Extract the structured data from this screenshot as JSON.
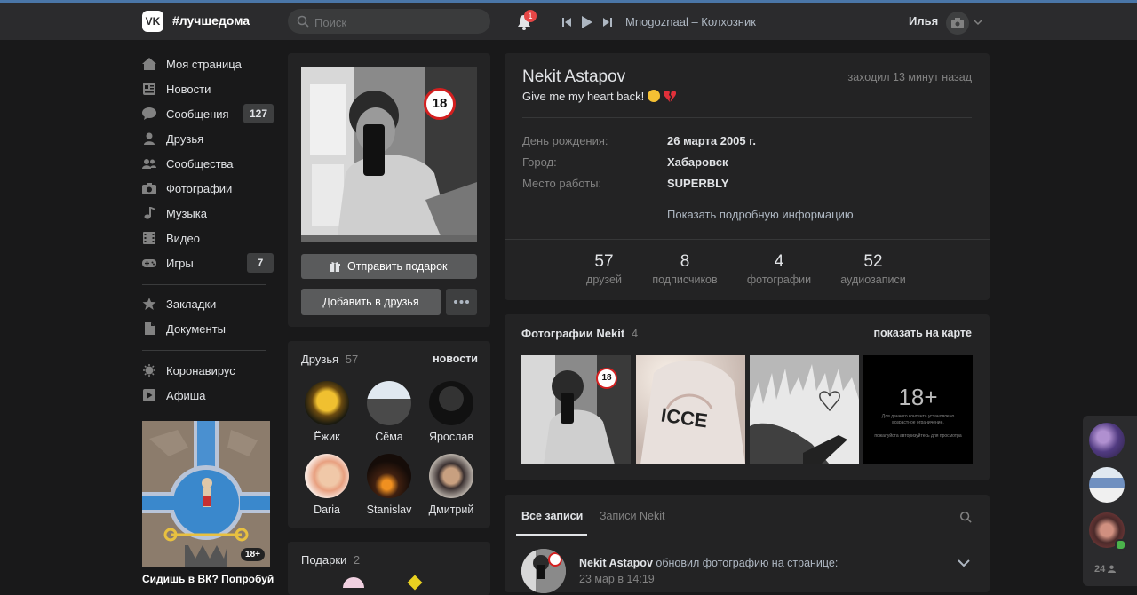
{
  "header": {
    "logo": "VK",
    "hashtag": "#лучшедома",
    "search_placeholder": "Поиск",
    "notifications_count": "1",
    "track": "Mnogoznaal – Колхозник",
    "user_name": "Илья"
  },
  "nav": {
    "items": [
      {
        "label": "Моя страница",
        "icon": "home-icon"
      },
      {
        "label": "Новости",
        "icon": "news-icon"
      },
      {
        "label": "Сообщения",
        "icon": "chat-icon",
        "count": "127"
      },
      {
        "label": "Друзья",
        "icon": "person-icon"
      },
      {
        "label": "Сообщества",
        "icon": "groups-icon"
      },
      {
        "label": "Фотографии",
        "icon": "camera-icon"
      },
      {
        "label": "Музыка",
        "icon": "music-icon"
      },
      {
        "label": "Видео",
        "icon": "video-icon"
      },
      {
        "label": "Игры",
        "icon": "gamepad-icon",
        "count": "7"
      }
    ],
    "items2": [
      {
        "label": "Закладки",
        "icon": "star-icon"
      },
      {
        "label": "Документы",
        "icon": "document-icon"
      }
    ],
    "items3": [
      {
        "label": "Коронавирус",
        "icon": "virus-icon"
      },
      {
        "label": "Афиша",
        "icon": "play-icon"
      }
    ]
  },
  "ad": {
    "badge": "18+",
    "title": "Сидишь в ВК? Попробуй"
  },
  "profile": {
    "badge18": "18",
    "gift_button": "Отправить подарок",
    "add_friend_button": "Добавить в друзья",
    "name": "Nekit Astapov",
    "status": "Give me my heart back!",
    "last_seen": "заходил 13 минут назад",
    "fields": [
      {
        "label": "День рождения:",
        "value": "26 марта 2005 г."
      },
      {
        "label": "Город:",
        "value": "Хабаровск"
      },
      {
        "label": "Место работы:",
        "value": "SUPERBLY"
      }
    ],
    "more_info": "Показать подробную информацию",
    "stats": [
      {
        "num": "57",
        "label": "друзей"
      },
      {
        "num": "8",
        "label": "подписчиков"
      },
      {
        "num": "4",
        "label": "фотографии"
      },
      {
        "num": "52",
        "label": "аудиозаписи"
      }
    ]
  },
  "friends": {
    "title": "Друзья",
    "count": "57",
    "news_link": "новости",
    "list": [
      {
        "name": "Ёжик"
      },
      {
        "name": "Сёма"
      },
      {
        "name": "Ярослав"
      },
      {
        "name": "Daria"
      },
      {
        "name": "Stanislav"
      },
      {
        "name": "Дмитрий"
      }
    ]
  },
  "gifts": {
    "title": "Подарки",
    "count": "2"
  },
  "photos": {
    "title": "Фотографии Nekit",
    "count": "4",
    "map_link": "показать на карте",
    "badge18": "18",
    "hoodie_text": "ICCE",
    "restricted_big": "18+",
    "restricted_text1": "Для данного контента установлено возрастное ограничение.",
    "restricted_text2": "пожалуйста авторизуйтесь для просмотра"
  },
  "wall": {
    "tabs": [
      "Все записи",
      "Записи Nekit"
    ],
    "post_author": "Nekit Astapov",
    "post_action": " обновил фотографию на странице:",
    "post_date": "23 мар в 14:19"
  },
  "rightbar": {
    "count": "24"
  },
  "colors": {
    "accent": "#4a76a8",
    "background": "#19191a",
    "card": "#232324",
    "badge_red": "#e64646"
  }
}
